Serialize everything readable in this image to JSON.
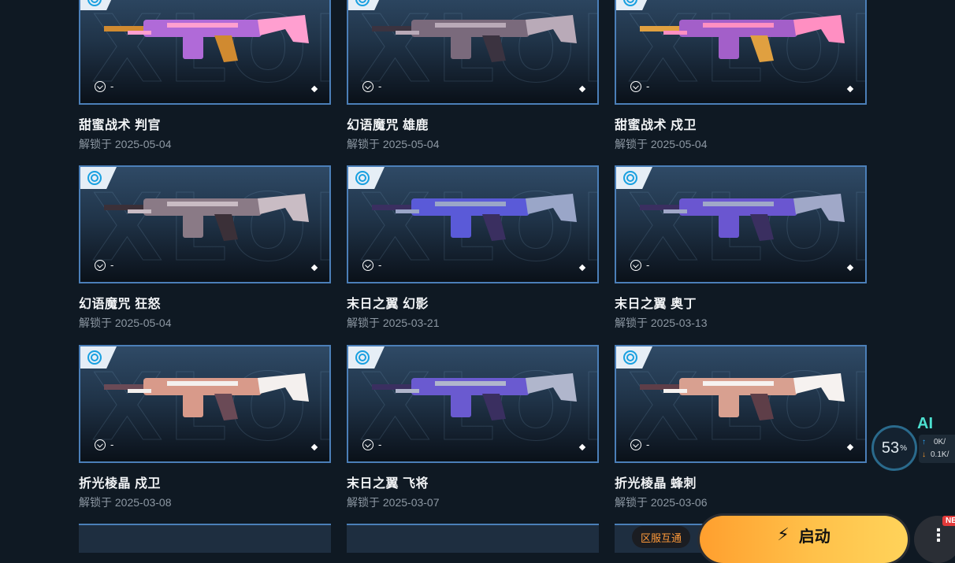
{
  "bg_watermark": "XLOI",
  "currency_value": "-",
  "skins": [
    {
      "name": "甜蜜战术 判官",
      "date": "解锁于 2025-05-04",
      "palette": [
        "#b06ad8",
        "#ff9fd0",
        "#d08a30"
      ]
    },
    {
      "name": "幻语魔咒 雄鹿",
      "date": "解锁于 2025-05-04",
      "palette": [
        "#7a6a7c",
        "#b9aab8",
        "#3b3340"
      ]
    },
    {
      "name": "甜蜜战术 戍卫",
      "date": "解锁于 2025-05-04",
      "palette": [
        "#a35fc9",
        "#ff8fc2",
        "#e0a040"
      ]
    },
    {
      "name": "幻语魔咒 狂怒",
      "date": "解锁于 2025-05-04",
      "palette": [
        "#8a7a86",
        "#c9bcc4",
        "#3b3038"
      ]
    },
    {
      "name": "末日之翼 幻影",
      "date": "解锁于 2025-03-21",
      "palette": [
        "#5a5ad8",
        "#9aa6c8",
        "#3a2f60"
      ]
    },
    {
      "name": "末日之翼 奥丁",
      "date": "解锁于 2025-03-13",
      "palette": [
        "#6a56d0",
        "#a0a8c8",
        "#3a2f60"
      ]
    },
    {
      "name": "折光棱晶 戍卫",
      "date": "解锁于 2025-03-08",
      "palette": [
        "#d89a8a",
        "#f4f0ee",
        "#6a4a56"
      ]
    },
    {
      "name": "末日之翼 飞将",
      "date": "解锁于 2025-03-07",
      "palette": [
        "#6a5ad0",
        "#b0b6cc",
        "#3a2f60"
      ]
    },
    {
      "name": "折光棱晶 蜂刺",
      "date": "解锁于 2025-03-06",
      "palette": [
        "#d8a090",
        "#f6f2f0",
        "#5e3e48"
      ]
    }
  ],
  "ai_widget": {
    "label": "AI",
    "percent": "53",
    "percent_sign": "%",
    "upload": "0K/",
    "download": "0.1K/"
  },
  "bottom_bar": {
    "region_label": "区服互通",
    "launch_label": "启动",
    "more_label": "⋮",
    "new_badge": "NE"
  },
  "colors": {
    "card_border": "#4b7fb8",
    "tier_ring": "#19a0e0",
    "launch_start": "#ff9f2e",
    "launch_end": "#ffd35a"
  }
}
